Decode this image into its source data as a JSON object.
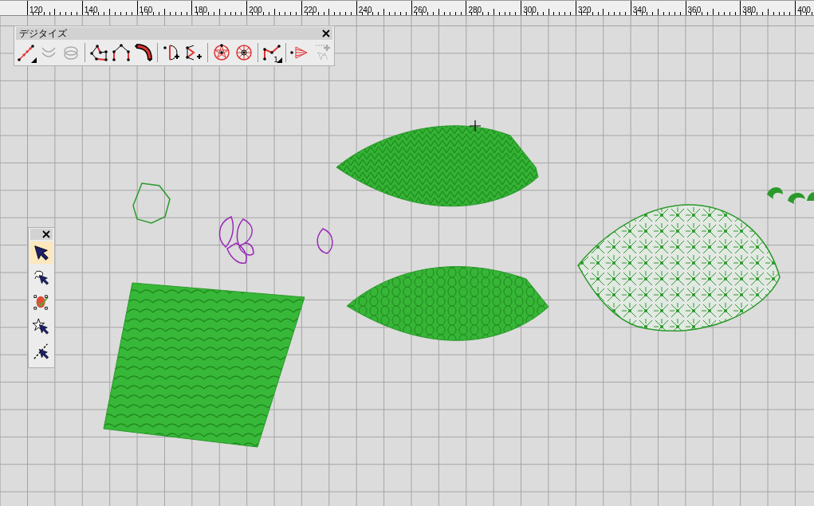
{
  "ruler": {
    "labels": [
      "120",
      "140",
      "160",
      "180",
      "200",
      "220",
      "240",
      "260",
      "280",
      "300",
      "320",
      "340",
      "360",
      "380",
      "400"
    ]
  },
  "digitize_toolbar": {
    "title": "デジタイズ",
    "groups": [
      [
        {
          "kind": "chain",
          "disabled": false,
          "flyout": true
        },
        {
          "kind": "mirror",
          "disabled": true,
          "flyout": false
        },
        {
          "kind": "rings",
          "disabled": true,
          "flyout": false
        }
      ],
      [
        {
          "kind": "polygon",
          "disabled": false,
          "flyout": false
        },
        {
          "kind": "arch",
          "disabled": false,
          "flyout": false
        },
        {
          "kind": "curve",
          "disabled": false,
          "flyout": false
        }
      ],
      [
        {
          "kind": "halfcircle",
          "disabled": false,
          "flyout": false
        },
        {
          "kind": "fan",
          "disabled": false,
          "flyout": false
        }
      ],
      [
        {
          "kind": "star",
          "disabled": false,
          "flyout": false
        },
        {
          "kind": "wheel",
          "disabled": false,
          "flyout": false
        }
      ],
      [
        {
          "kind": "zigzag",
          "disabled": false,
          "flyout": true,
          "badge": "1"
        }
      ],
      [
        {
          "kind": "cone",
          "disabled": false,
          "flyout": false
        },
        {
          "kind": "addpoint",
          "disabled": true,
          "flyout": false
        }
      ]
    ]
  },
  "select_toolbar": {
    "tools": [
      {
        "kind": "arrow",
        "selected": true
      },
      {
        "kind": "lasso",
        "selected": false
      },
      {
        "kind": "object",
        "selected": false
      },
      {
        "kind": "star",
        "selected": false
      },
      {
        "kind": "line",
        "selected": false
      }
    ]
  }
}
